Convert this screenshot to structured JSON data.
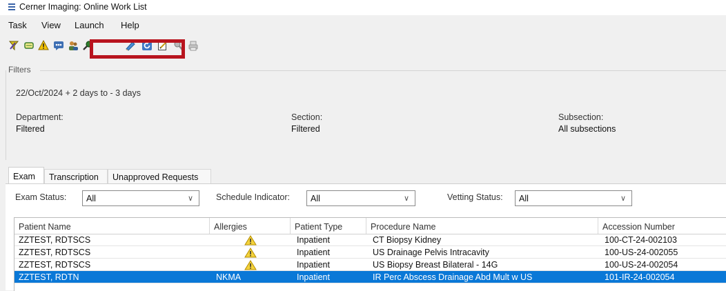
{
  "window": {
    "title": "Cerner Imaging: Online Work List"
  },
  "menu": [
    "Task",
    "View",
    "Launch",
    "Help"
  ],
  "toolbar": {
    "icons": [
      "filter-icon",
      "scroll-icon",
      "alert-icon",
      "chat-icon",
      "users-icon",
      "search-icon",
      "edit-icon",
      "refresh-icon",
      "notepad-icon",
      "person-search-icon",
      "print-icon"
    ],
    "highlight_color": "#b8141e"
  },
  "filters": {
    "legend": "Filters",
    "date_range": "22/Oct/2024 + 2 days to - 3 days",
    "department": {
      "label": "Department:",
      "value": "Filtered"
    },
    "section": {
      "label": "Section:",
      "value": "Filtered"
    },
    "subsection": {
      "label": "Subsection:",
      "value": "All subsections"
    }
  },
  "tabs": [
    "Exam",
    "Transcription",
    "Unapproved Requests"
  ],
  "status_filters": {
    "exam_status": {
      "label": "Exam Status:",
      "value": "All"
    },
    "schedule_indicator": {
      "label": "Schedule Indicator:",
      "value": "All"
    },
    "vetting_status": {
      "label": "Vetting Status:",
      "value": "All"
    }
  },
  "grid": {
    "columns": [
      "Patient Name",
      "Allergies",
      "Patient Type",
      "Procedure Name",
      "Accession Number"
    ],
    "rows": [
      {
        "patient": "ZZTEST, RDTSCS",
        "allergies": "warning-icon",
        "type": "Inpatient",
        "procedure": "CT Biopsy Kidney",
        "accession": "100-CT-24-002103",
        "selected": false
      },
      {
        "patient": "ZZTEST, RDTSCS",
        "allergies": "warning-icon",
        "type": "Inpatient",
        "procedure": "US Drainage Pelvis Intracavity",
        "accession": "100-US-24-002055",
        "selected": false
      },
      {
        "patient": "ZZTEST, RDTSCS",
        "allergies": "warning-icon",
        "type": "Inpatient",
        "procedure": "US Biopsy Breast Bilateral - 14G",
        "accession": "100-US-24-002054",
        "selected": false
      },
      {
        "patient": "ZZTEST, RDTN",
        "allergies": "NKMA",
        "type": "Inpatient",
        "procedure": "IR Perc Abscess Drainage Abd Mult w US",
        "accession": "101-IR-24-002054",
        "selected": true
      }
    ],
    "selected_color": "#0a78d7"
  }
}
